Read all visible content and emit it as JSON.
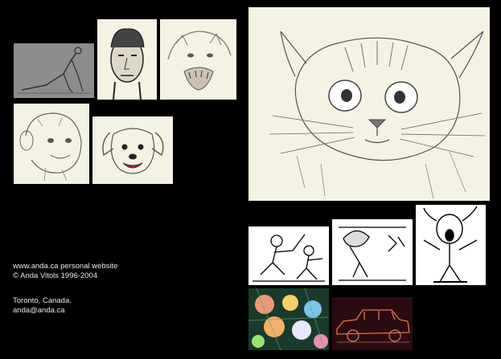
{
  "footer": {
    "site_line": "www.anda.ca personal website",
    "copyright_line": "© Anda Vitols 1996-2004",
    "location_line": "Toronto, Canada.",
    "email": "anda@anda.ca"
  },
  "gallery": {
    "items": [
      {
        "icon": "yoga-figure-sketch"
      },
      {
        "icon": "man-portrait-sketch"
      },
      {
        "icon": "snarling-cougar-sketch"
      },
      {
        "icon": "monkey-sketch"
      },
      {
        "icon": "puppy-sketch"
      },
      {
        "icon": "kitten-sketch"
      },
      {
        "icon": "hockey-players-cartoon"
      },
      {
        "icon": "robot-cartoon"
      },
      {
        "icon": "screaming-figure-cartoon"
      },
      {
        "icon": "flowers-painting"
      },
      {
        "icon": "vintage-car-painting"
      }
    ]
  },
  "colors": {
    "background": "#000000",
    "text": "#e8e8e8",
    "paper": "#f5f2e4"
  }
}
